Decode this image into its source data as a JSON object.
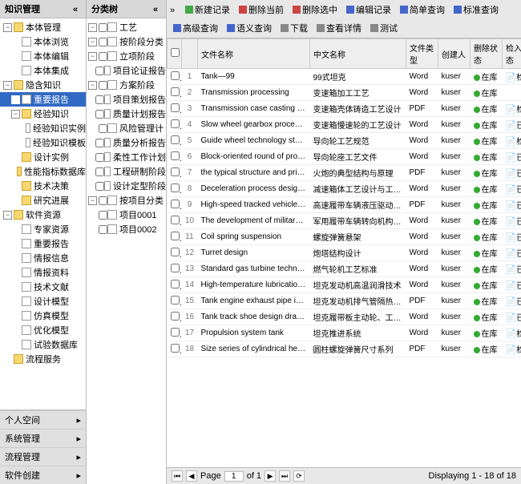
{
  "left": {
    "title": "知识管理",
    "tree": [
      {
        "l": "本体管理",
        "lvl": 0,
        "open": true,
        "icon": "folder"
      },
      {
        "l": "本体浏览",
        "lvl": 1,
        "icon": "file"
      },
      {
        "l": "本体编辑",
        "lvl": 1,
        "icon": "file"
      },
      {
        "l": "本体集成",
        "lvl": 1,
        "icon": "file"
      },
      {
        "l": "隐含知识",
        "lvl": 0,
        "open": true,
        "icon": "folder"
      },
      {
        "l": "重要报告",
        "lvl": 1,
        "icon": "file",
        "selected": true
      },
      {
        "l": "经验知识",
        "lvl": 1,
        "open": true,
        "icon": "folder"
      },
      {
        "l": "经验知识实例",
        "lvl": 2,
        "icon": "file"
      },
      {
        "l": "经验知识模板",
        "lvl": 2,
        "icon": "file"
      },
      {
        "l": "设计实例",
        "lvl": 1,
        "icon": "folder"
      },
      {
        "l": "性能指标数据库",
        "lvl": 1,
        "icon": "folder"
      },
      {
        "l": "技术决策",
        "lvl": 1,
        "icon": "folder"
      },
      {
        "l": "研究进展",
        "lvl": 1,
        "icon": "folder"
      },
      {
        "l": "软件资源",
        "lvl": 0,
        "open": true,
        "icon": "folder"
      },
      {
        "l": "专家资源",
        "lvl": 1,
        "icon": "file"
      },
      {
        "l": "重要报告",
        "lvl": 1,
        "icon": "file"
      },
      {
        "l": "情报信息",
        "lvl": 1,
        "icon": "file"
      },
      {
        "l": "情报资料",
        "lvl": 1,
        "icon": "file"
      },
      {
        "l": "技术文献",
        "lvl": 1,
        "icon": "file"
      },
      {
        "l": "设计模型",
        "lvl": 1,
        "icon": "file"
      },
      {
        "l": "仿真模型",
        "lvl": 1,
        "icon": "file"
      },
      {
        "l": "优化模型",
        "lvl": 1,
        "icon": "file"
      },
      {
        "l": "试验数据库",
        "lvl": 1,
        "icon": "file"
      },
      {
        "l": "流程服务",
        "lvl": 0,
        "icon": "folder"
      }
    ],
    "accordion": [
      "个人空间",
      "系统管理",
      "流程管理",
      "软件创建"
    ]
  },
  "mid": {
    "title": "分类树",
    "tree": [
      {
        "l": "工艺",
        "lvl": 0,
        "open": true
      },
      {
        "l": "按阶段分类",
        "lvl": 1,
        "open": true
      },
      {
        "l": "立项阶段",
        "lvl": 2,
        "open": true
      },
      {
        "l": "项目论证报告",
        "lvl": 3
      },
      {
        "l": "方案阶段",
        "lvl": 2,
        "open": true
      },
      {
        "l": "项目策划报告",
        "lvl": 3
      },
      {
        "l": "质量计划报告",
        "lvl": 3
      },
      {
        "l": "风险管理计",
        "lvl": 3
      },
      {
        "l": "质量分析报告",
        "lvl": 3
      },
      {
        "l": "柔性工作计划",
        "lvl": 3
      },
      {
        "l": "工程研制阶段",
        "lvl": 2
      },
      {
        "l": "设计定型阶段",
        "lvl": 2
      },
      {
        "l": "按项目分类",
        "lvl": 1,
        "open": true
      },
      {
        "l": "项目0001",
        "lvl": 2
      },
      {
        "l": "项目0002",
        "lvl": 2
      }
    ]
  },
  "toolbar": [
    {
      "l": "新建记录",
      "c": "green"
    },
    {
      "l": "删除当前",
      "c": "red"
    },
    {
      "l": "删除选中",
      "c": "red"
    },
    {
      "l": "编辑记录",
      "c": "blue"
    },
    {
      "l": "简单查询",
      "c": "blue"
    },
    {
      "l": "标准查询",
      "c": "blue"
    },
    {
      "l": "高级查询",
      "c": "blue"
    },
    {
      "l": "语义查询",
      "c": "blue"
    },
    {
      "l": "下载",
      "c": "gray"
    },
    {
      "l": "查看详情",
      "c": "gray"
    },
    {
      "l": "测试",
      "c": "gray"
    }
  ],
  "columns": [
    "",
    "",
    "文件名称",
    "中文名称",
    "文件类型",
    "创建人",
    "删除状态",
    "检入状态"
  ],
  "rows": [
    {
      "en": "Tank—99",
      "cn": "99式坦克",
      "t": "Word",
      "u": "kuser",
      "st": "在库",
      "in": "检入"
    },
    {
      "en": "Transmission processing",
      "cn": "变速箱加工工艺",
      "t": "Word",
      "u": "kuser",
      "st": "在库",
      "in": ""
    },
    {
      "en": "Transmission case casting proce...",
      "cn": "变速箱壳体铸造工艺设计",
      "t": "PDF",
      "u": "kuser",
      "st": "在库",
      "in": "检入"
    },
    {
      "en": "Slow wheel gearbox process de...",
      "cn": "变速箱慢速轮的工艺设计",
      "t": "Word",
      "u": "kuser",
      "st": "在库",
      "in": "已检出"
    },
    {
      "en": "Guide wheel technology standar...",
      "cn": "导向轮工艺规范",
      "t": "Word",
      "u": "kuser",
      "st": "在库",
      "in": "检入"
    },
    {
      "en": "Block-oriented round of process...",
      "cn": "导向轮座工艺文件",
      "t": "Word",
      "u": "kuser",
      "st": "在库",
      "in": "已检出"
    },
    {
      "en": "the typical structure and princip...",
      "cn": "火炮的典型结构与原理",
      "t": "PDF",
      "u": "kuser",
      "st": "在库",
      "in": "已检出"
    },
    {
      "en": "Deceleration process design and...",
      "cn": "减速箱体工艺设计与工差设计",
      "t": "Word",
      "u": "kuser",
      "st": "在库",
      "in": "已检出"
    },
    {
      "en": "High-speed tracked vehicle hydr...",
      "cn": "高速履带车辆液压驱动转向技术",
      "t": "PDF",
      "u": "kuser",
      "st": "在库",
      "in": "已检出"
    },
    {
      "en": "The development of military tra...",
      "cn": "军用履带车辆转向机构发展综述",
      "t": "Word",
      "u": "kuser",
      "st": "在库",
      "in": "已检出"
    },
    {
      "en": "Coil spring suspension",
      "cn": "螺旋弹簧悬架",
      "t": "Word",
      "u": "kuser",
      "st": "在库",
      "in": "已检出"
    },
    {
      "en": "Turret design",
      "cn": "炮塔结构设计",
      "t": "Word",
      "u": "kuser",
      "st": "在库",
      "in": "已检出"
    },
    {
      "en": "Standard gas turbine technology",
      "cn": "燃气轮机工艺标准",
      "t": "Word",
      "u": "kuser",
      "st": "在库",
      "in": "已检出"
    },
    {
      "en": "High-temperature lubrication te...",
      "cn": "坦克发动机高温润滑技术",
      "t": "Word",
      "u": "kuser",
      "st": "在库",
      "in": "已检出"
    },
    {
      "en": "Tank engine exhaust pipe insula...",
      "cn": "坦克发动机排气管隔热技术研究",
      "t": "PDF",
      "u": "kuser",
      "st": "在库",
      "in": "已检出"
    },
    {
      "en": "Tank track shoe design drawing...",
      "cn": "坦克履带板主动轮、工艺工装设计",
      "t": "Word",
      "u": "kuser",
      "st": "在库",
      "in": "已检出"
    },
    {
      "en": "Propulsion system tank",
      "cn": "坦克推进系统",
      "t": "Word",
      "u": "kuser",
      "st": "在库",
      "in": "检入"
    },
    {
      "en": "Size series of cylindrical helical sp...",
      "cn": "圆柱螺旋弹簧尺寸系列",
      "t": "PDF",
      "u": "kuser",
      "st": "在库",
      "in": "检入"
    }
  ],
  "footer": {
    "page_label": "Page",
    "page": "1",
    "of_label": "of 1",
    "display": "Displaying 1 - 18 of 18"
  }
}
